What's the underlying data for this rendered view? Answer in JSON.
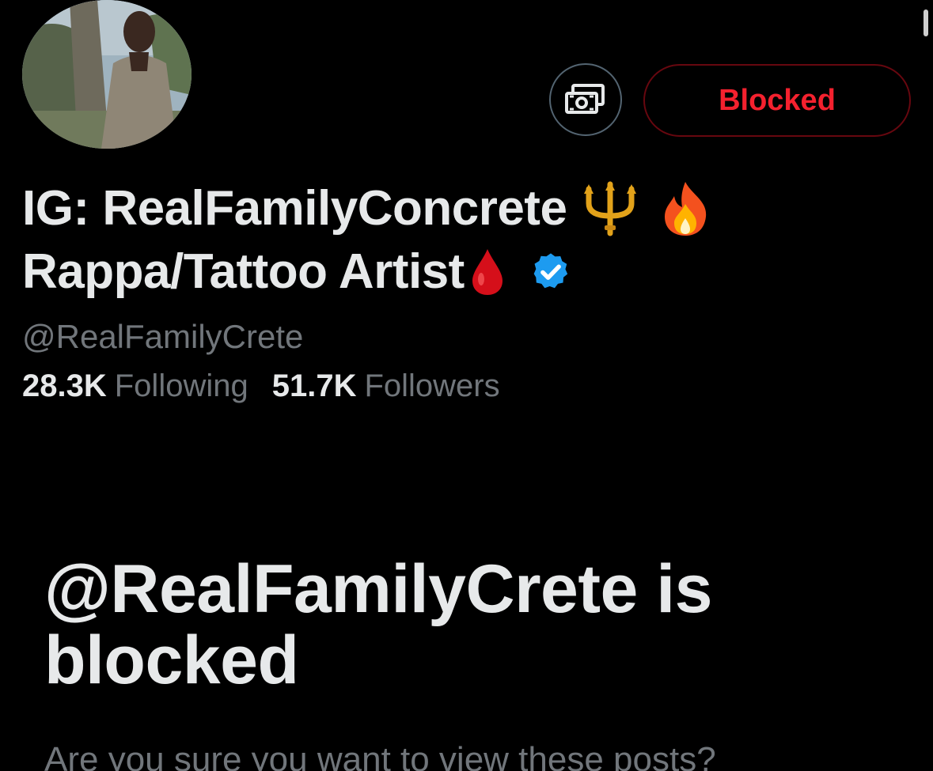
{
  "profile": {
    "display_name_line1": "IG: RealFamilyConcrete",
    "display_name_line2": "Rappa/Tattoo Artist",
    "emojis_line1": [
      "trident-emoji",
      "fire-emoji"
    ],
    "emoji_line2": "drop-of-blood-emoji",
    "verified_badge": "verified-badge-icon",
    "handle": "@RealFamilyCrete",
    "following_count": "28.3K",
    "following_label": "Following",
    "followers_count": "51.7K",
    "followers_label": "Followers"
  },
  "actions": {
    "tip_icon": "money-icon",
    "blocked_label": "Blocked"
  },
  "blocked_notice": {
    "title": "@RealFamilyCrete is blocked",
    "subtitle": "Are you sure you want to view these posts?"
  },
  "colors": {
    "background": "#000000",
    "primary_text": "#e7e9ea",
    "secondary_text": "#71767b",
    "blocked_red": "#f4212e",
    "blocked_border": "#67070f",
    "verified_blue": "#1d9bf0"
  }
}
